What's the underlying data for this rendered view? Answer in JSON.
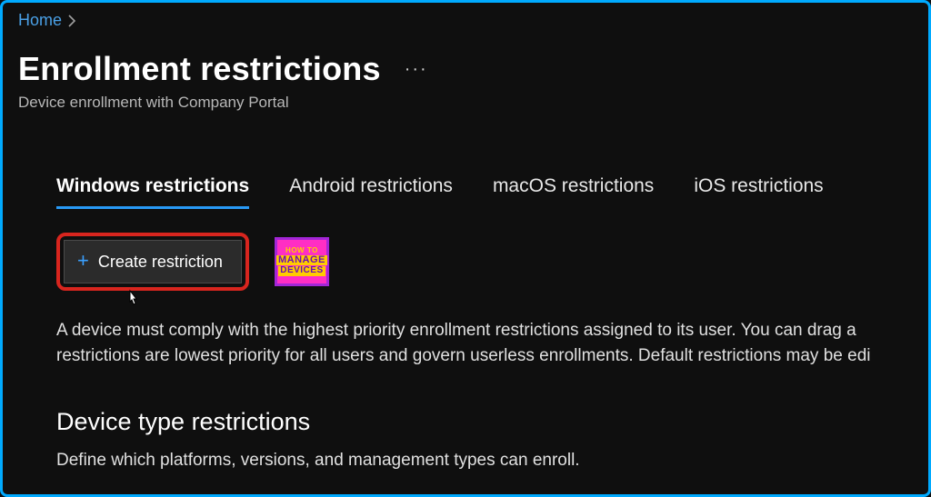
{
  "breadcrumb": {
    "home": "Home"
  },
  "header": {
    "title": "Enrollment restrictions",
    "subtitle": "Device enrollment with Company Portal"
  },
  "tabs": [
    {
      "label": "Windows restrictions",
      "active": true
    },
    {
      "label": "Android restrictions",
      "active": false
    },
    {
      "label": "macOS restrictions",
      "active": false
    },
    {
      "label": "iOS restrictions",
      "active": false
    }
  ],
  "toolbar": {
    "create_label": "Create restriction"
  },
  "badge": {
    "line1": "HOW TO",
    "line2": "MANAGE",
    "line3": "DEVICES"
  },
  "description": "A device must comply with the highest priority enrollment restrictions assigned to its user. You can drag a restrictions are lowest priority for all users and govern userless enrollments. Default restrictions may be edi",
  "section": {
    "title": "Device type restrictions",
    "desc": "Define which platforms, versions, and management types can enroll."
  }
}
